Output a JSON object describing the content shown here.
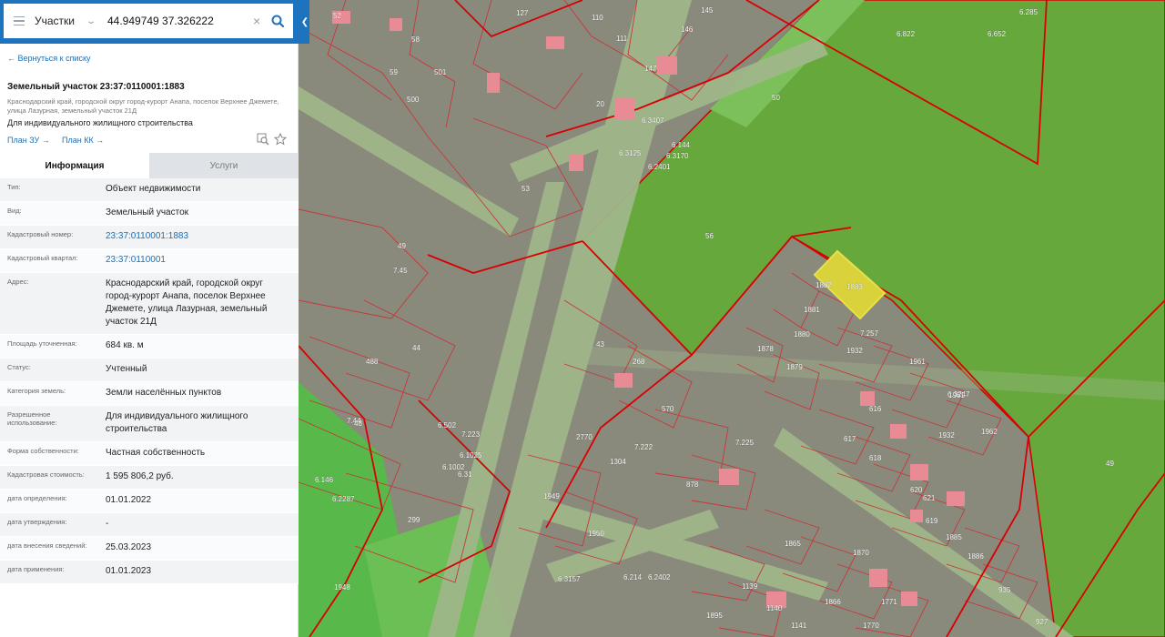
{
  "search": {
    "type_label": "Участки",
    "query": "44.949749 37.326222"
  },
  "panel": {
    "back_label": "← Вернуться к списку",
    "title": "Земельный участок 23:37:0110001:1883",
    "address_small": "Краснодарский край, городской округ город-курорт Анапа, поселок Верхнее Джемете, улица Лазурная, земельный участок 21Д",
    "purpose": "Для индивидуального жилищного строительства",
    "plan_zu_label": "План ЗУ →",
    "plan_kk_label": "План КК →",
    "tabs": [
      {
        "label": "Информация",
        "active": true
      },
      {
        "label": "Услуги",
        "active": false
      }
    ],
    "fields": [
      {
        "key": "Тип:",
        "value": "Объект недвижимости",
        "link": false
      },
      {
        "key": "Вид:",
        "value": "Земельный участок",
        "link": false
      },
      {
        "key": "Кадастровый номер:",
        "value": "23:37:0110001:1883",
        "link": true
      },
      {
        "key": "Кадастровый квартал:",
        "value": "23:37:0110001",
        "link": true
      },
      {
        "key": "Адрес:",
        "value": "Краснодарский край, городской округ город-курорт Анапа, поселок Верхнее Джемете, улица Лазурная, земельный участок 21Д",
        "link": false
      },
      {
        "key": "Площадь уточненная:",
        "value": "684 кв. м",
        "link": false
      },
      {
        "key": "Статус:",
        "value": "Учтенный",
        "link": false
      },
      {
        "key": "Категория земель:",
        "value": "Земли населённых пунктов",
        "link": false
      },
      {
        "key": "Разрешенное использование:",
        "value": "Для индивидуального жилищного строительства",
        "link": false
      },
      {
        "key": "Форма собственности:",
        "value": "Частная собственность",
        "link": false
      },
      {
        "key": "Кадастровая стоимость:",
        "value": "1 595 806,2 руб.",
        "link": false
      },
      {
        "key": "дата определения:",
        "value": "01.01.2022",
        "link": false
      },
      {
        "key": "дата утверждения:",
        "value": "-",
        "link": false
      },
      {
        "key": "дата внесения сведений:",
        "value": "25.03.2023",
        "link": false
      },
      {
        "key": "дата применения:",
        "value": "01.01.2023",
        "link": false
      }
    ]
  },
  "map": {
    "colors": {
      "parcel_fill": "#8a8a7c",
      "green_field": "#66a83c",
      "bright_green": "#58b84a",
      "road": "#a0b78a",
      "border_red": "#d80000",
      "selected": "#d9d23a",
      "building": "#e98b95"
    },
    "labels": [
      "6.285",
      "6.822",
      "6.652",
      "50",
      "56",
      "49",
      "52",
      "127",
      "110",
      "145",
      "58",
      "111",
      "146",
      "59",
      "501",
      "147",
      "500",
      "20",
      "6.3407",
      "6.3125",
      "6.144",
      "6.3170",
      "6.2401",
      "53",
      "49",
      "7.45",
      "1883",
      "1882",
      "1881",
      "1880",
      "1878",
      "1879",
      "1932",
      "1961",
      "43",
      "268",
      "570",
      "488",
      "44",
      "7.44",
      "48",
      "616",
      "7.222",
      "7.225",
      "1962",
      "617",
      "2770",
      "1304",
      "878",
      "1949",
      "299",
      "1950",
      "6.3157",
      "1948",
      "1139",
      "1140",
      "1141",
      "1895",
      "1865",
      "1870",
      "1771",
      "1770",
      "935",
      "927",
      "1866",
      "6.214",
      "6.2402",
      "6.146",
      "6.2287",
      "7.257",
      "6.3247",
      "618",
      "620",
      "621",
      "619",
      "1885",
      "1886",
      "1932",
      "1961",
      "6.502",
      "6.1025",
      "6.1002",
      "6.31",
      "7.223"
    ]
  }
}
